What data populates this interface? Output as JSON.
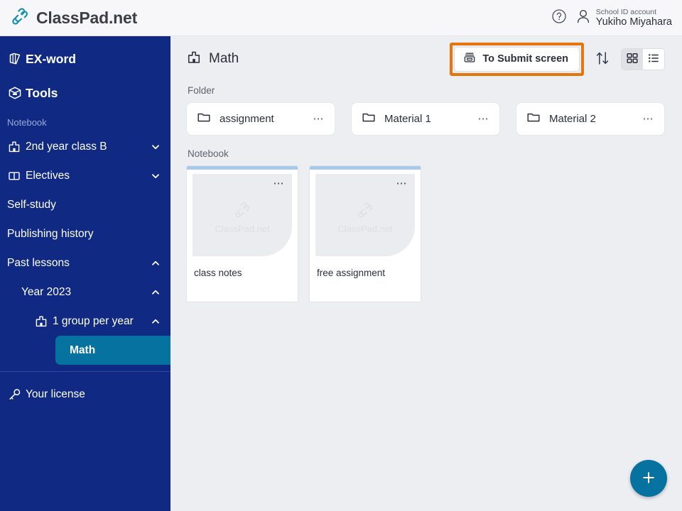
{
  "app": {
    "brand_name": "ClassPad.net",
    "accent_teal": "#0672a0",
    "sidebar_navy": "#102a83",
    "highlight_orange": "#e8740c",
    "content_bg": "#eceef1"
  },
  "topbar": {
    "help_label": "Help",
    "account_kind": "School ID account",
    "account_name": "Yukiho Miyahara"
  },
  "sidebar": {
    "primary": [
      {
        "label": "EX-word",
        "icon": "dictionary-icon"
      },
      {
        "label": "Tools",
        "icon": "toolbox-icon"
      }
    ],
    "section_label": "Notebook",
    "items": [
      {
        "label": "2nd year class B",
        "icon": "class-group-icon",
        "chevron": "down",
        "level": 0
      },
      {
        "label": "Electives",
        "icon": "book-icon",
        "chevron": "down",
        "level": 0
      },
      {
        "label": "Self-study",
        "icon": "",
        "chevron": "",
        "level": 0
      },
      {
        "label": "Publishing history",
        "icon": "",
        "chevron": "",
        "level": 0
      },
      {
        "label": "Past lessons",
        "icon": "",
        "chevron": "up",
        "level": 0
      },
      {
        "label": "Year 2023",
        "icon": "",
        "chevron": "up",
        "level": 1
      },
      {
        "label": "1 group per year",
        "icon": "class-group-icon",
        "chevron": "up",
        "level": 2
      },
      {
        "label": "Math",
        "icon": "",
        "chevron": "",
        "level": 3,
        "active": true
      }
    ],
    "license_label": "Your license"
  },
  "main": {
    "page_title": "Math",
    "submit_button": "To Submit screen",
    "sort_label": "Sort",
    "view_grid_label": "Grid view",
    "view_list_label": "List view",
    "folder_group_label": "Folder",
    "folders": [
      {
        "name": "assignment"
      },
      {
        "name": "Material 1"
      },
      {
        "name": "Material 2"
      }
    ],
    "notebook_group_label": "Notebook",
    "notebooks": [
      {
        "title": "class notes",
        "watermark": "ClassPad.net"
      },
      {
        "title": "free assignment",
        "watermark": "ClassPad.net"
      }
    ],
    "fab_label": "+"
  }
}
